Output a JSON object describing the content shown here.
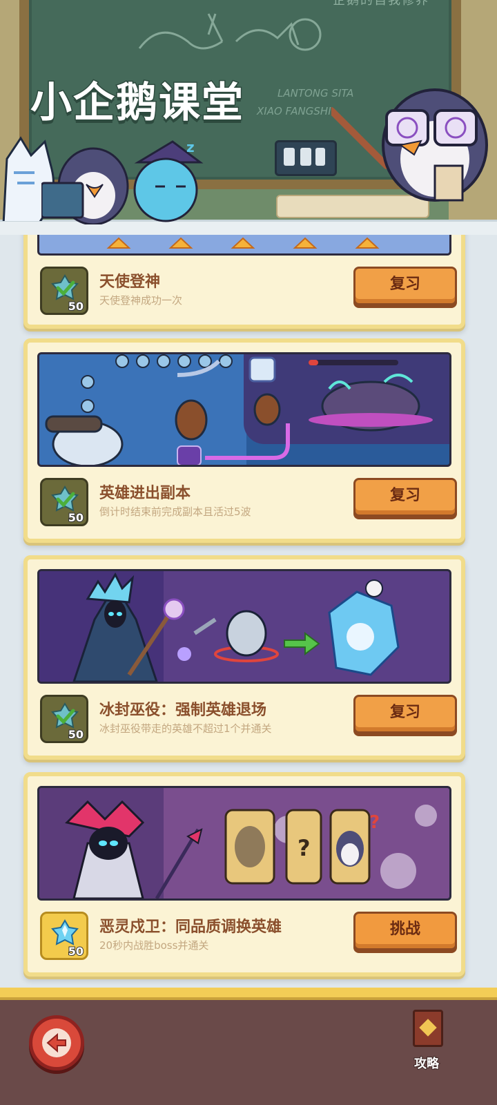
{
  "header": {
    "title": "小企鹅课堂",
    "board_text": "企鹅的自我修养",
    "board_scribble_1": "LANTONG SITA",
    "board_scribble_2": "XIAO FANGSHI"
  },
  "cards": [
    {
      "name": "天使登神",
      "desc": "天使登神成功一次",
      "badge_value": "50",
      "badge_type": "green-check",
      "button_label": "复习",
      "button_state": "completed"
    },
    {
      "name": "英雄进出副本",
      "desc": "倒计时结束前完成副本且活过5波",
      "badge_value": "50",
      "badge_type": "green-check",
      "button_label": "复习",
      "button_state": "completed"
    },
    {
      "name": "冰封巫役：强制英雄退场",
      "desc": "冰封巫役带走的英雄不超过1个并通关",
      "badge_value": "50",
      "badge_type": "green-check",
      "button_label": "复习",
      "button_state": "completed"
    },
    {
      "name": "恶灵戍卫：同品质调换英雄",
      "desc": "20秒内战胜boss并通关",
      "badge_value": "50",
      "badge_type": "blue-crystal",
      "button_label": "挑战",
      "button_state": "available"
    }
  ],
  "bottom": {
    "guide_label": "攻略"
  },
  "colors": {
    "card_bg": "#fbf3d4",
    "card_border": "#f1dc8a",
    "button": "#f1a047",
    "task_name": "#8a4f2c",
    "bottom_bar": "#6a4a49"
  }
}
